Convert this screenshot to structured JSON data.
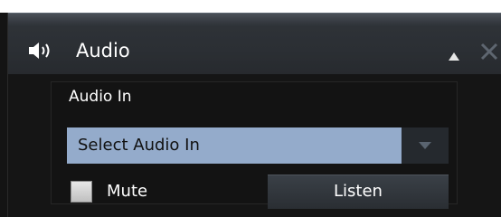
{
  "panel": {
    "title": "Audio",
    "icons": {
      "header": "speaker-icon",
      "collapse": "collapse-icon",
      "close": "close-icon"
    }
  },
  "audio_in": {
    "label": "Audio In",
    "selected": "Select Audio In"
  },
  "mute": {
    "label": "Mute",
    "checked": false
  },
  "listen_button": {
    "label": "Listen"
  },
  "colors": {
    "select_highlight": "#94abcb",
    "background": "#141414",
    "header": "#2e3237"
  }
}
